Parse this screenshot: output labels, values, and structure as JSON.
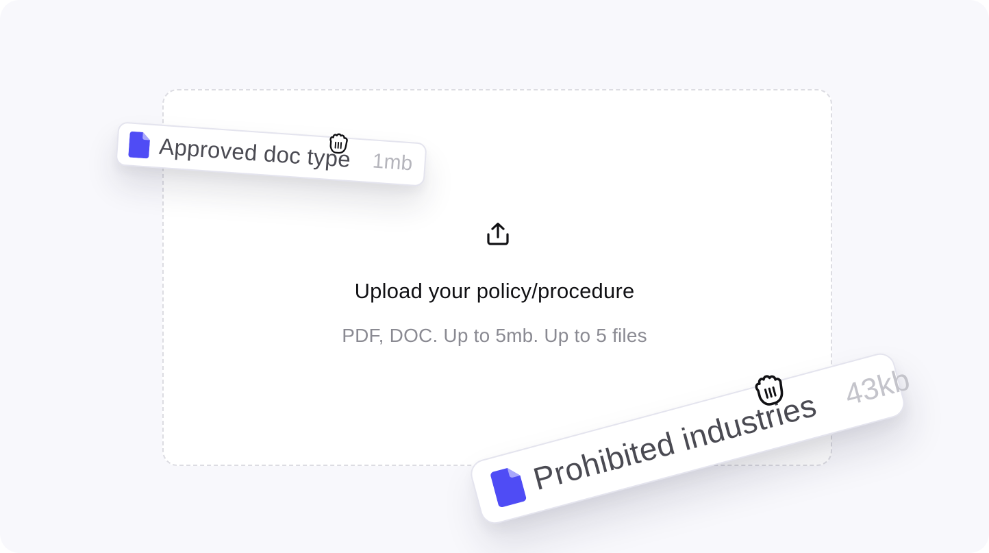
{
  "dropzone": {
    "icon": "upload-icon",
    "title": "Upload your policy/procedure",
    "subtitle": "PDF, DOC. Up to 5mb. Up to 5 files"
  },
  "files": [
    {
      "icon": "file-icon",
      "name": "Approved doc type",
      "size": "1mb"
    },
    {
      "icon": "file-icon",
      "name": "Prohibited industries",
      "size": "43kb"
    }
  ],
  "cursor": {
    "icon": "grab-hand-cursor-icon"
  },
  "colors": {
    "background": "#f8f8fc",
    "accent": "#4f4cf5",
    "dropzone_border": "#dcdce2",
    "title_text": "#111114",
    "muted_text": "#8a8a92"
  }
}
